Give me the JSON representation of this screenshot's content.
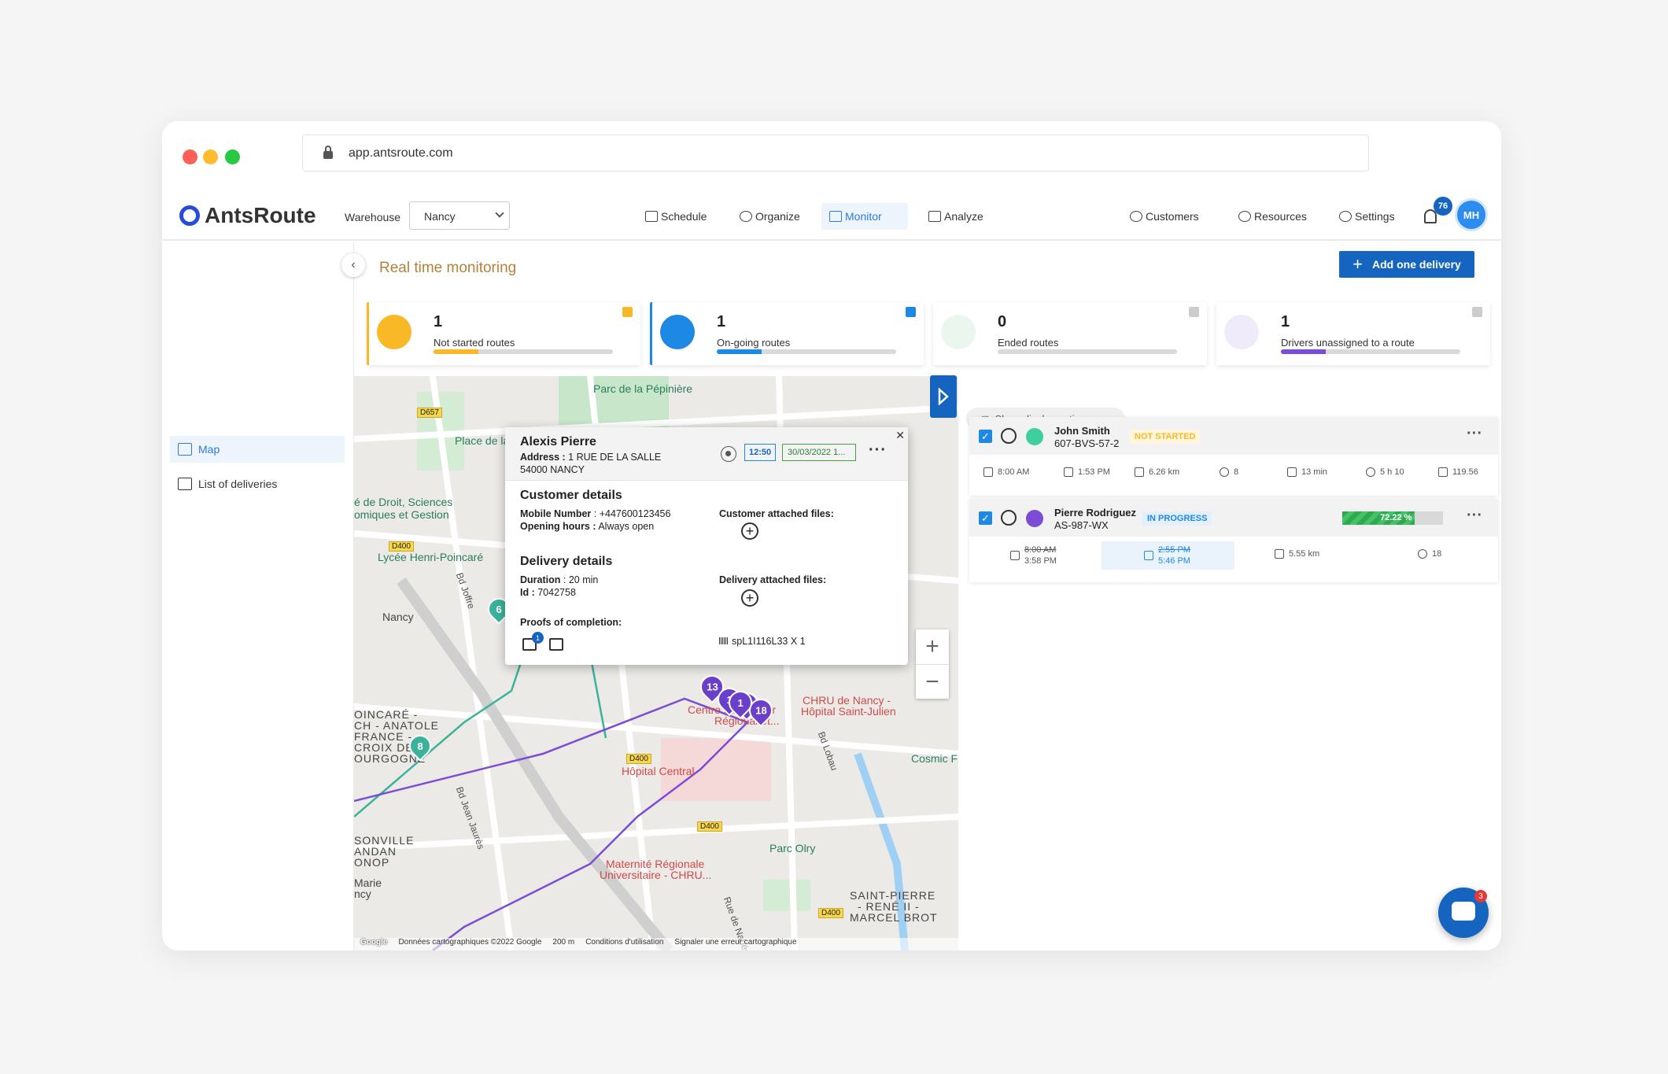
{
  "browser": {
    "url": "app.antsroute.com"
  },
  "nav": {
    "logo_text": "AntsRoute",
    "warehouse_label": "Warehouse",
    "warehouse_value": "Nancy",
    "items": [
      "Schedule",
      "Organize",
      "Monitor",
      "Analyze"
    ],
    "active": "Monitor",
    "right_items": [
      "Customers",
      "Resources",
      "Settings"
    ],
    "notification_count": "76",
    "avatar_initials": "MH"
  },
  "sidebar": {
    "items": [
      {
        "label": "Map"
      },
      {
        "label": "List of deliveries"
      }
    ]
  },
  "page": {
    "title": "Real time monitoring",
    "add_button": "Add one delivery"
  },
  "stats": [
    {
      "count": "1",
      "label": "Not started routes",
      "color": "#f9b825",
      "progress": 0.25
    },
    {
      "count": "1",
      "label": "On-going routes",
      "color": "#1e88e5",
      "progress": 0.25
    },
    {
      "count": "0",
      "label": "Ended routes",
      "color": "#43a047",
      "progress": 0
    },
    {
      "count": "1",
      "label": "Drivers unassigned to a route",
      "color": "#7b4dd6",
      "progress": 0.25
    }
  ],
  "popup": {
    "name": "Alexis Pierre",
    "address_label": "Address :",
    "address_line1": "1 RUE DE LA SALLE",
    "address_line2": "54000 NANCY",
    "time": "12:50",
    "date": "30/03/2022 1...",
    "customer_details_title": "Customer details",
    "mobile_label": "Mobile Number",
    "mobile_value": ": +447600123456",
    "hours_label": "Opening hours :",
    "hours_value": "Always open",
    "customer_files_label": "Customer attached files:",
    "delivery_details_title": "Delivery details",
    "duration_label": "Duration",
    "duration_value": ": 20 min",
    "id_label": "Id :",
    "id_value": "7042758",
    "delivery_files_label": "Delivery attached files:",
    "proofs_label": "Proofs of completion:",
    "proof_badge": "1",
    "barcode": "spL1I116L33 X 1"
  },
  "map": {
    "labels": [
      "Parc de la Pépinière",
      "Place de la",
      "é de Droit, Sciences",
      "omiques et Gestion",
      "Lycée Henri-Poincaré",
      "Nancy",
      "OINCARÉ -",
      "CH - ANATOLE",
      "FRANCE -",
      "CROIX DE",
      "OURGOGNE",
      "SONVILLE",
      "ANDAN",
      "ONOP",
      "Marie",
      "ncy",
      "Hôpital Central",
      "Maternité Régionale",
      "Universitaire - CHRU...",
      "Parc Olry",
      "CHRU de Nancy -",
      "Hôpital Saint-Julien",
      "Cosmic F",
      "SAINT-PIERRE",
      "- RENÉ II -",
      "MARCEL BROT",
      "Centre Hospitalier",
      "Régional et..."
    ],
    "road_labels": [
      "D657",
      "D400",
      "D400",
      "D400",
      "D400",
      "D400",
      "Bd Joffre",
      "Bd Jean Jaurès",
      "Bd Lobau",
      "Rue de Nabécor"
    ],
    "pins_purple": [
      "13",
      "1",
      "17",
      "18",
      "1"
    ],
    "pins_green": [
      "6",
      "8"
    ],
    "footer": [
      "Google",
      "Données cartographiques ©2022 Google",
      "200 m",
      "Conditions d'utilisation",
      "Signaler une erreur cartographique"
    ]
  },
  "right_panel": {
    "show_options": "Show display options",
    "routes": [
      {
        "name": "John Smith",
        "plate": "607-BVS-57-2",
        "status": "NOT STARTED",
        "status_color": "#f9b825",
        "dot_color": "#3ecf9d",
        "start": "8:00 AM",
        "end": "1:53 PM",
        "distance": "6.26 km",
        "stops": "8",
        "drive": "13 min",
        "work": "5 h 10",
        "cost": "119.56"
      },
      {
        "name": "Pierre Rodriguez",
        "plate": "AS-987-WX",
        "status": "IN PROGRESS",
        "status_color": "#1e88e5",
        "dot_color": "#7b4dd6",
        "progress": "72.22 %",
        "start_old": "8:00 AM",
        "start_new": "3:58 PM",
        "end_old": "2:55 PM",
        "end_new": "5:46 PM",
        "distance": "5.55 km",
        "stops": "18"
      }
    ]
  },
  "chat": {
    "badge": "3"
  }
}
